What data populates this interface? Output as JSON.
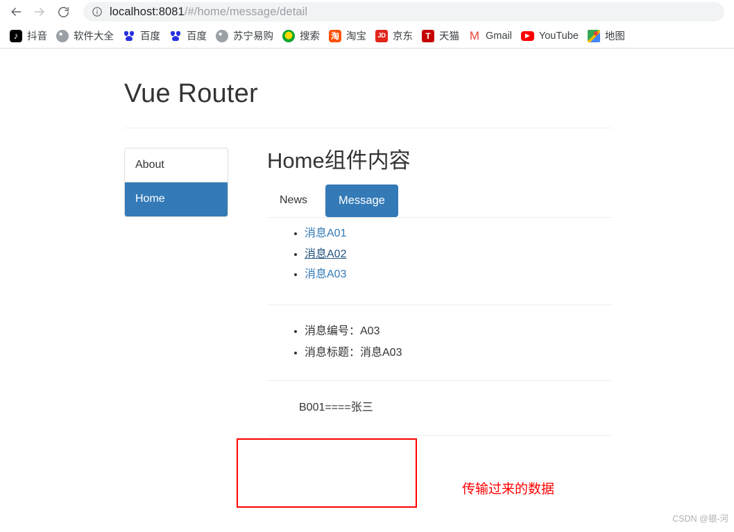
{
  "browser": {
    "back_label": "Back",
    "forward_label": "Forward",
    "reload_label": "Reload",
    "site_info_label": "View site information",
    "url_host": "localhost:8081",
    "url_path": "/#/home/message/detail",
    "url_full": "localhost:8081/#/home/message/detail"
  },
  "bookmarks": [
    {
      "label": "抖音",
      "icon": "douyin-icon"
    },
    {
      "label": "软件大全",
      "icon": "globe-icon"
    },
    {
      "label": "百度",
      "icon": "baidu-icon"
    },
    {
      "label": "百度",
      "icon": "baidu-icon"
    },
    {
      "label": "苏宁易购",
      "icon": "globe-icon"
    },
    {
      "label": "搜索",
      "icon": "sou-icon"
    },
    {
      "label": "淘宝",
      "icon": "taobao-icon"
    },
    {
      "label": "京东",
      "icon": "jd-icon"
    },
    {
      "label": "天猫",
      "icon": "tmall-icon"
    },
    {
      "label": "Gmail",
      "icon": "gmail-icon"
    },
    {
      "label": "YouTube",
      "icon": "youtube-icon"
    },
    {
      "label": "地图",
      "icon": "maps-icon"
    }
  ],
  "page": {
    "jumbotron_title": "Vue Router",
    "sidebar": {
      "items": [
        {
          "label": "About",
          "active": false
        },
        {
          "label": "Home",
          "active": true
        }
      ]
    },
    "main": {
      "title": "Home组件内容",
      "tabs": [
        {
          "label": "News",
          "active": false
        },
        {
          "label": "Message",
          "active": true
        }
      ],
      "message_links": [
        {
          "label": "消息A01",
          "hovered": false
        },
        {
          "label": "消息A02",
          "hovered": true
        },
        {
          "label": "消息A03",
          "hovered": false
        }
      ],
      "detail": [
        "消息编号：A03",
        "消息标题：消息A03"
      ],
      "transfer_data": "B001====张三"
    }
  },
  "annotations": {
    "red_note": "传输过来的数据",
    "red_color": "#ff0000"
  },
  "watermark": "CSDN @银-河",
  "colors": {
    "primary_blue": "#337ab7",
    "link_blue": "#337ab7",
    "text": "#333333",
    "rule": "#eeeeee"
  }
}
